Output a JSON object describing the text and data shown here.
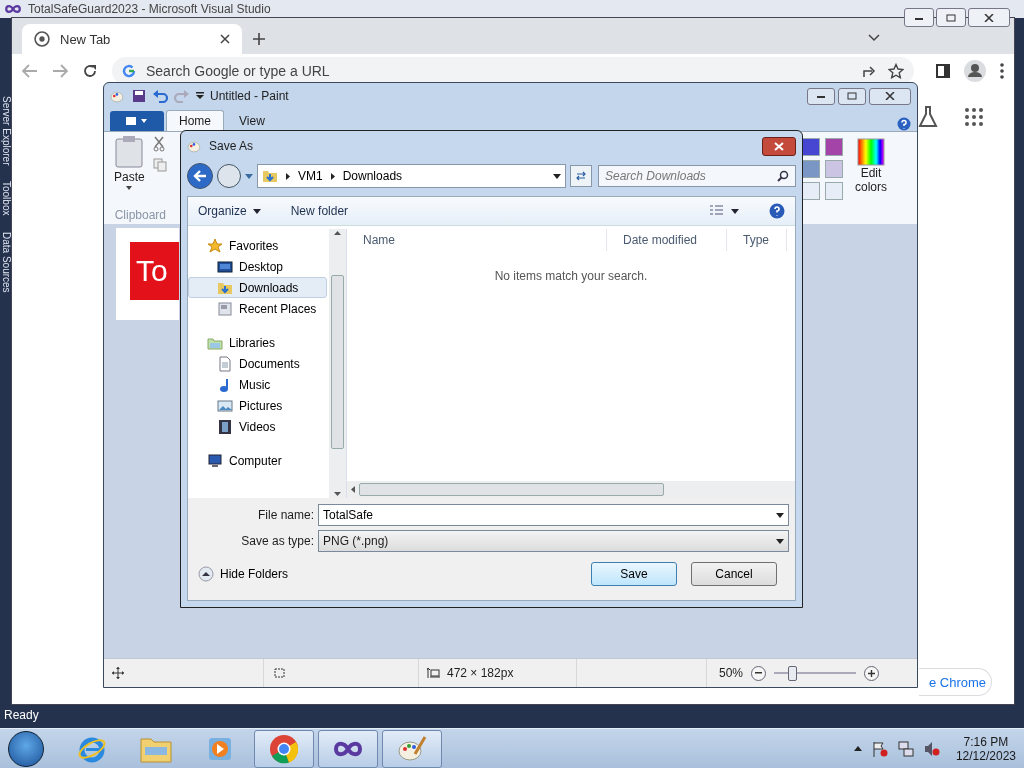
{
  "vs_window": {
    "title": "TotalSafeGuard2023 - Microsoft Visual Studio",
    "side_tabs": [
      "Server Explorer",
      "Toolbox",
      "Data Sources"
    ],
    "status": "Ready"
  },
  "browser": {
    "tabs": [
      {
        "label": "New Tab",
        "selected": true
      }
    ],
    "omnibox": {
      "placeholder": "Search Google or type a URL"
    },
    "customize_button": "e Chrome"
  },
  "paint": {
    "title": "Untitled - Paint",
    "ribbon_tabs": [
      {
        "label": "Home",
        "selected": true
      },
      {
        "label": "View",
        "selected": false
      }
    ],
    "paste_label": "Paste",
    "group_label": "Clipboard",
    "swatches": [
      {
        "color": "#4646d2"
      },
      {
        "color": "#a444a8"
      },
      {
        "color": "#7a96c4"
      },
      {
        "color": "#cbc4e2"
      },
      {
        "color": "#e6edf6"
      },
      {
        "color": "#e6edf6"
      }
    ],
    "edit_colors": "Edit colors",
    "canvas_text": "To",
    "status": {
      "size": "472 × 182px",
      "zoom": "50%"
    },
    "zoom_slider": {
      "level": 0.22
    }
  },
  "save_dialog": {
    "title": "Save As",
    "path": [
      "VM1",
      "Downloads"
    ],
    "search": {
      "placeholder": "Search Downloads"
    },
    "toolbar": [
      "Organize",
      "New folder"
    ],
    "nav_tree": [
      {
        "label": "Favorites",
        "kind": "star",
        "selected": false,
        "children": [
          {
            "label": "Desktop",
            "kind": "desktop",
            "selected": false
          },
          {
            "label": "Downloads",
            "kind": "downloads",
            "selected": true
          },
          {
            "label": "Recent Places",
            "kind": "recent",
            "selected": false
          }
        ]
      },
      {
        "label": "Libraries",
        "kind": "library",
        "selected": false,
        "children": [
          {
            "label": "Documents",
            "kind": "documents",
            "selected": false
          },
          {
            "label": "Music",
            "kind": "music",
            "selected": false
          },
          {
            "label": "Pictures",
            "kind": "pictures",
            "selected": false
          },
          {
            "label": "Videos",
            "kind": "videos",
            "selected": false
          }
        ]
      },
      {
        "label": "Computer",
        "kind": "computer",
        "selected": false
      }
    ],
    "columns": [
      "Name",
      "Date modified",
      "Type"
    ],
    "empty_message": "No items match your search.",
    "file_name": {
      "label": "File name:",
      "value": "TotalSafe"
    },
    "save_type": {
      "label": "Save as type:",
      "value": "PNG (*.png)"
    },
    "hide_folders": "Hide Folders",
    "buttons": [
      {
        "label": "Save",
        "default": true
      },
      {
        "label": "Cancel",
        "default": false
      }
    ]
  },
  "taskbar": {
    "apps": [
      {
        "kind": "ie",
        "running": false
      },
      {
        "kind": "explorer",
        "running": false
      },
      {
        "kind": "media",
        "running": false
      },
      {
        "kind": "chrome",
        "running": true
      },
      {
        "kind": "vs",
        "running": true
      },
      {
        "kind": "paint",
        "running": true
      }
    ],
    "clock": {
      "time": "7:16 PM",
      "date": "12/12/2023"
    }
  }
}
